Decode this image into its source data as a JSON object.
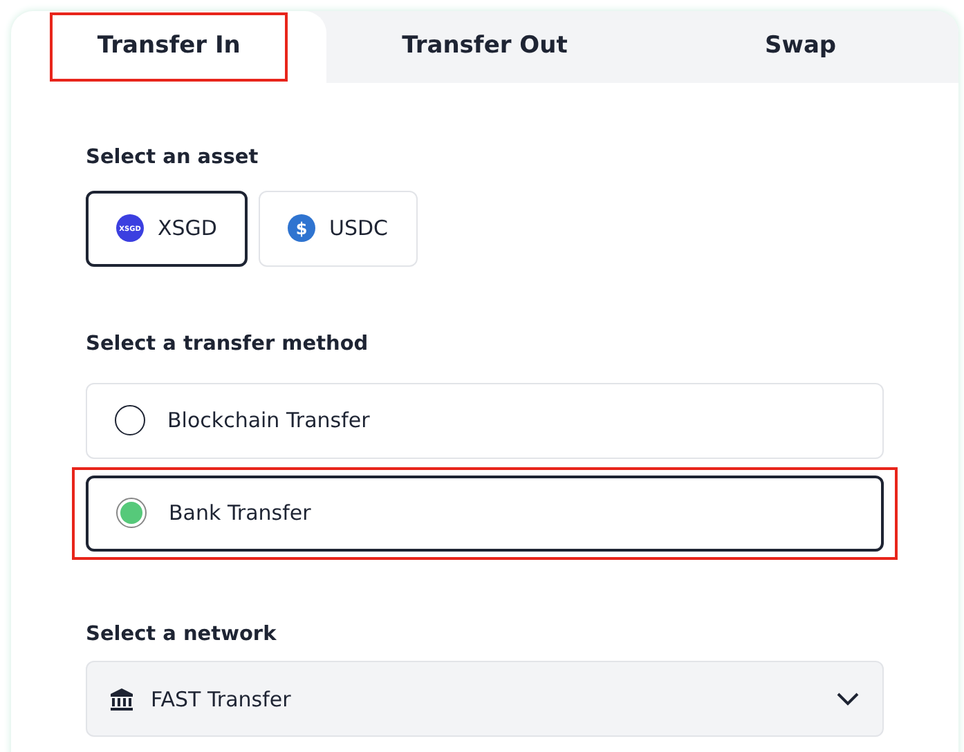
{
  "tabs": [
    {
      "label": "Transfer In",
      "selected": true,
      "highlighted": true
    },
    {
      "label": "Transfer Out",
      "selected": false,
      "highlighted": false
    },
    {
      "label": "Swap",
      "selected": false,
      "highlighted": false
    }
  ],
  "asset_section": {
    "heading": "Select an asset",
    "assets": [
      {
        "label": "XSGD",
        "icon_text": "XSGD",
        "selected": true
      },
      {
        "label": "USDC",
        "icon_text": "$",
        "selected": false
      }
    ]
  },
  "method_section": {
    "heading": "Select a transfer method",
    "methods": [
      {
        "label": "Blockchain Transfer",
        "selected": false,
        "highlighted": false
      },
      {
        "label": "Bank Transfer",
        "selected": true,
        "highlighted": true
      }
    ]
  },
  "network_section": {
    "heading": "Select a network",
    "value": "FAST Transfer"
  }
}
